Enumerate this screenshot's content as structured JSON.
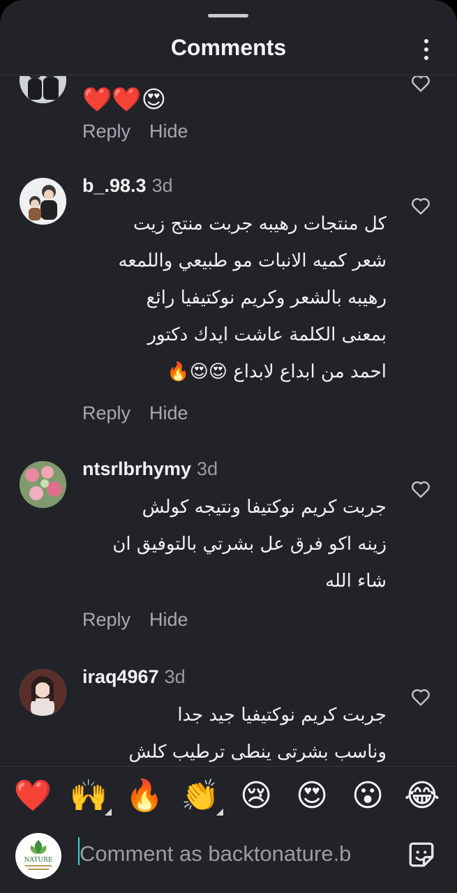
{
  "header": {
    "title": "Comments"
  },
  "comments": [
    {
      "username": "",
      "time": "",
      "text": "❤️❤️😍",
      "reply_label": "Reply",
      "hide_label": "Hide"
    },
    {
      "username": "b_.98.3",
      "time": "3d",
      "text": "كل منتجات رهيبه جربت منتج زيت\nشعر كميه الانبات مو طبيعي واللمعه\nرهيبه بالشعر  وكريم نوكتيفيا رائع\nبمعنى الكلمة عاشت ايدك دكتور\nاحمد من ابداع لابداع 😍😍🔥",
      "reply_label": "Reply",
      "hide_label": "Hide"
    },
    {
      "username": "ntsrlbrhymy",
      "time": "3d",
      "text": "جربت كريم نوكتيفا ونتيجه كولش\nزينه اكو فرق عل بشرتي بالتوفيق ان\nشاء الله",
      "reply_label": "Reply",
      "hide_label": "Hide"
    },
    {
      "username": "iraq4967",
      "time": "3d",
      "text": "جربت كريم نوكتيفيا جيد جدا\nوناسب بشرتى ينطى ترطيب كلش",
      "reply_label": "",
      "hide_label": ""
    }
  ],
  "reactions": [
    {
      "emoji": "❤️",
      "icon": "red-heart-icon"
    },
    {
      "emoji": "🙌",
      "icon": "raising-hands-icon"
    },
    {
      "emoji": "🔥",
      "icon": "fire-icon"
    },
    {
      "emoji": "👏",
      "icon": "clapping-hands-icon"
    },
    {
      "emoji": "😢",
      "icon": "crying-face-icon"
    },
    {
      "emoji": "😍",
      "icon": "heart-eyes-icon"
    },
    {
      "emoji": "😮",
      "icon": "surprised-face-icon"
    },
    {
      "emoji": "😂",
      "icon": "tears-of-joy-icon"
    }
  ],
  "composer": {
    "placeholder": "Comment as backtonature.b",
    "logo_text": "NATURE"
  },
  "colors": {
    "background": "#212328",
    "accent": "#3fd4c9",
    "muted": "#a7aab0"
  }
}
